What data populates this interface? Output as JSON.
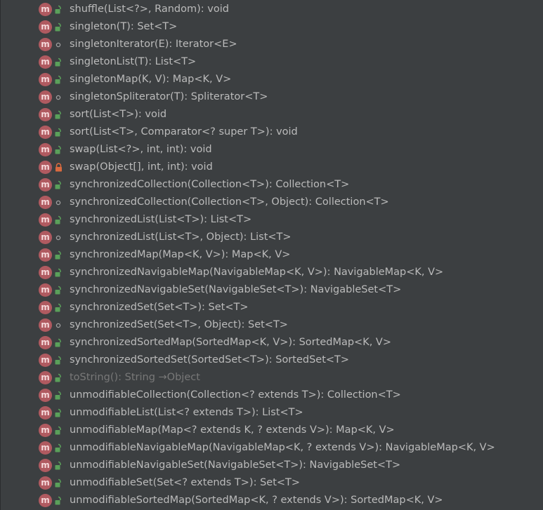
{
  "colors": {
    "background": "#3c3f41",
    "text": "#bbbbbb",
    "inherited_text": "#787878",
    "method_icon": "#b05a60",
    "public_lock": "#5aa05a",
    "private_lock": "#d96a3f",
    "package_dot": "#a0a0a0"
  },
  "icons": {
    "method_badge_letter": "m"
  },
  "members": [
    {
      "signature": "shuffle(List<?>, Random): void",
      "visibility": "public",
      "inherited": false
    },
    {
      "signature": "singleton(T): Set<T>",
      "visibility": "public",
      "inherited": false
    },
    {
      "signature": "singletonIterator(E): Iterator<E>",
      "visibility": "package",
      "inherited": false
    },
    {
      "signature": "singletonList(T): List<T>",
      "visibility": "public",
      "inherited": false
    },
    {
      "signature": "singletonMap(K, V): Map<K, V>",
      "visibility": "public",
      "inherited": false
    },
    {
      "signature": "singletonSpliterator(T): Spliterator<T>",
      "visibility": "package",
      "inherited": false
    },
    {
      "signature": "sort(List<T>): void",
      "visibility": "public",
      "inherited": false
    },
    {
      "signature": "sort(List<T>, Comparator<? super T>): void",
      "visibility": "public",
      "inherited": false
    },
    {
      "signature": "swap(List<?>, int, int): void",
      "visibility": "public",
      "inherited": false
    },
    {
      "signature": "swap(Object[], int, int): void",
      "visibility": "private",
      "inherited": false
    },
    {
      "signature": "synchronizedCollection(Collection<T>): Collection<T>",
      "visibility": "public",
      "inherited": false
    },
    {
      "signature": "synchronizedCollection(Collection<T>, Object): Collection<T>",
      "visibility": "package",
      "inherited": false
    },
    {
      "signature": "synchronizedList(List<T>): List<T>",
      "visibility": "public",
      "inherited": false
    },
    {
      "signature": "synchronizedList(List<T>, Object): List<T>",
      "visibility": "package",
      "inherited": false
    },
    {
      "signature": "synchronizedMap(Map<K, V>): Map<K, V>",
      "visibility": "public",
      "inherited": false
    },
    {
      "signature": "synchronizedNavigableMap(NavigableMap<K, V>): NavigableMap<K, V>",
      "visibility": "public",
      "inherited": false
    },
    {
      "signature": "synchronizedNavigableSet(NavigableSet<T>): NavigableSet<T>",
      "visibility": "public",
      "inherited": false
    },
    {
      "signature": "synchronizedSet(Set<T>): Set<T>",
      "visibility": "public",
      "inherited": false
    },
    {
      "signature": "synchronizedSet(Set<T>, Object): Set<T>",
      "visibility": "package",
      "inherited": false
    },
    {
      "signature": "synchronizedSortedMap(SortedMap<K, V>): SortedMap<K, V>",
      "visibility": "public",
      "inherited": false
    },
    {
      "signature": "synchronizedSortedSet(SortedSet<T>): SortedSet<T>",
      "visibility": "public",
      "inherited": false
    },
    {
      "signature": "toString(): String →Object",
      "visibility": "public",
      "inherited": true
    },
    {
      "signature": "unmodifiableCollection(Collection<? extends T>): Collection<T>",
      "visibility": "public",
      "inherited": false
    },
    {
      "signature": "unmodifiableList(List<? extends T>): List<T>",
      "visibility": "public",
      "inherited": false
    },
    {
      "signature": "unmodifiableMap(Map<? extends K, ? extends V>): Map<K, V>",
      "visibility": "public",
      "inherited": false
    },
    {
      "signature": "unmodifiableNavigableMap(NavigableMap<K, ? extends V>): NavigableMap<K, V>",
      "visibility": "public",
      "inherited": false
    },
    {
      "signature": "unmodifiableNavigableSet(NavigableSet<T>): NavigableSet<T>",
      "visibility": "public",
      "inherited": false
    },
    {
      "signature": "unmodifiableSet(Set<? extends T>): Set<T>",
      "visibility": "public",
      "inherited": false
    },
    {
      "signature": "unmodifiableSortedMap(SortedMap<K, ? extends V>): SortedMap<K, V>",
      "visibility": "public",
      "inherited": false
    }
  ]
}
